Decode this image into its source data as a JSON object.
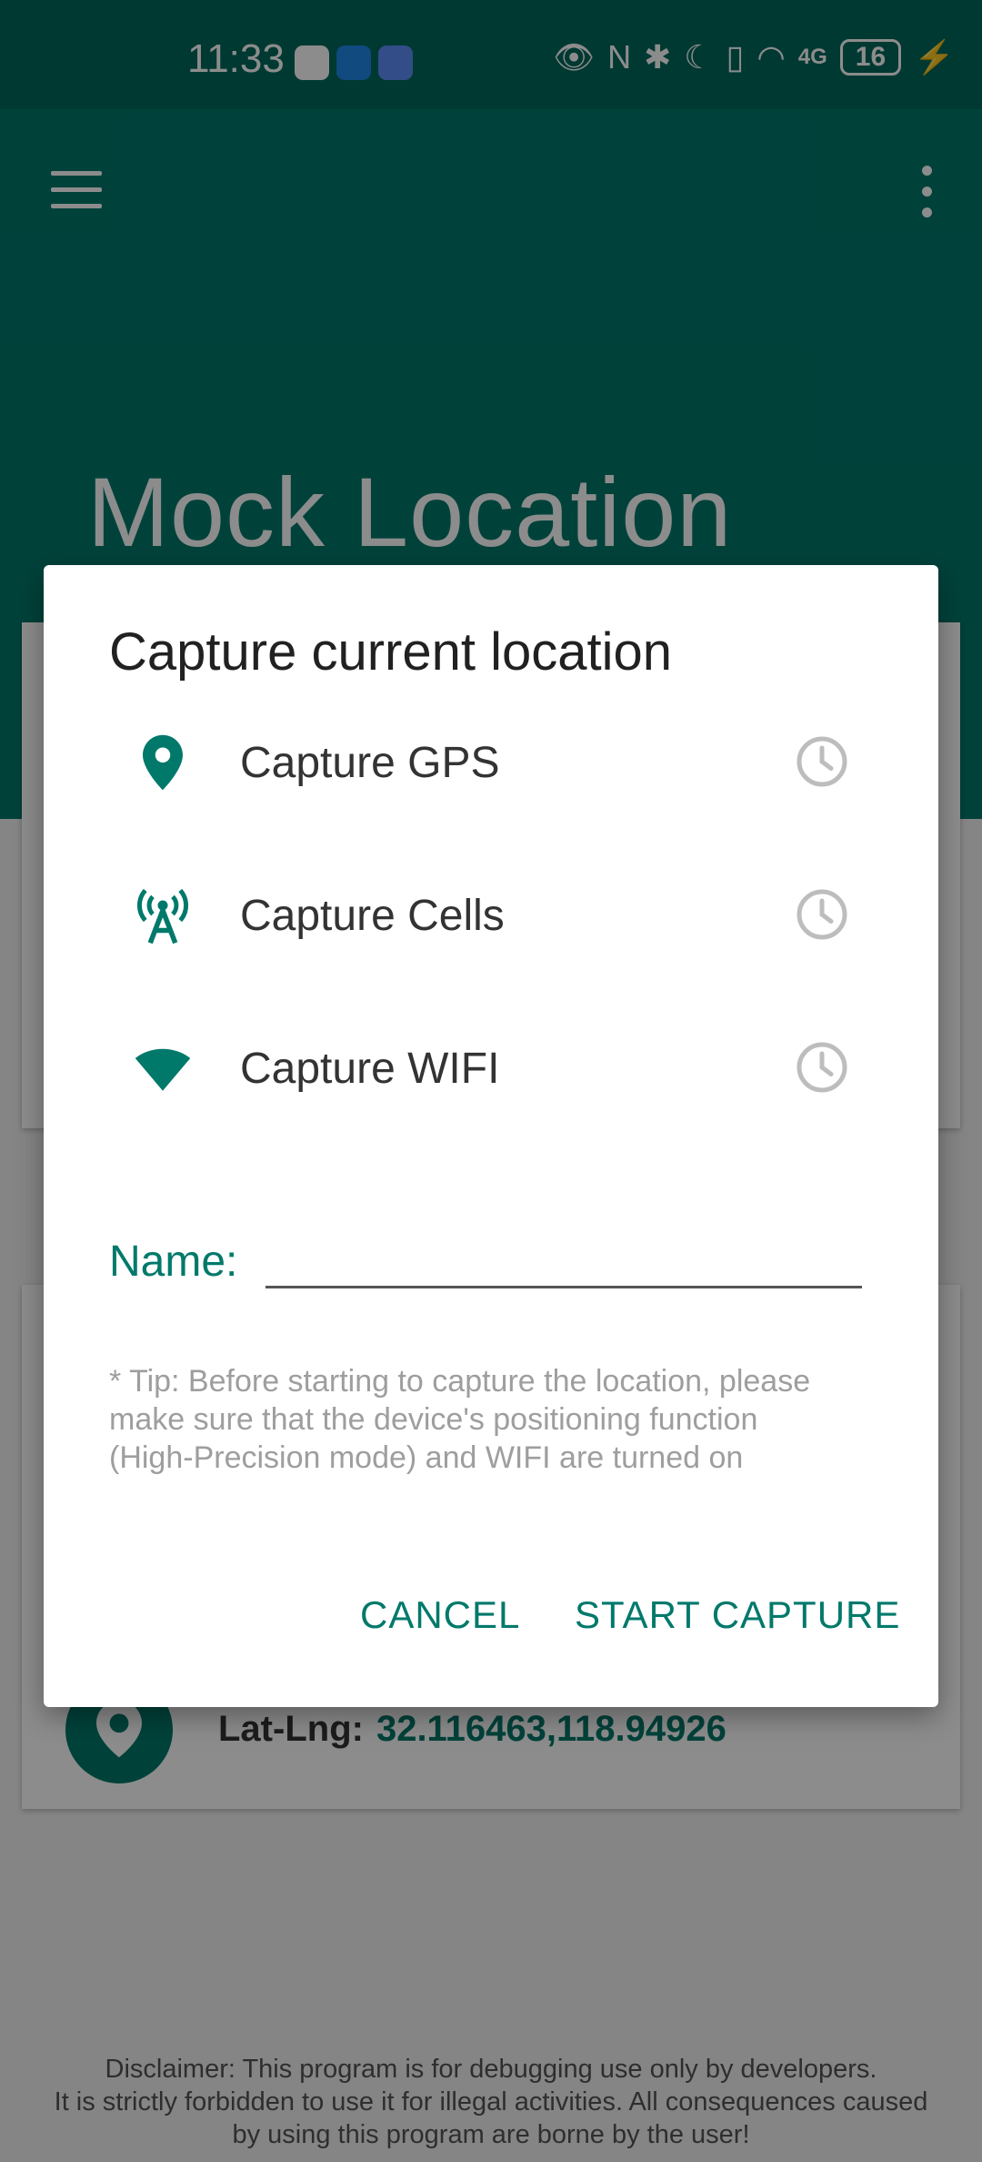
{
  "status_bar": {
    "time": "11:33",
    "battery": "16",
    "network": "4G"
  },
  "app": {
    "title": "Mock Location",
    "latlng_label": "Lat-Lng:",
    "latlng_value": "32.116463,118.94926",
    "disclaimer_lines": [
      "Disclaimer: This program is for debugging use only by developers.",
      "It is strictly forbidden to use it for illegal activities. All consequences caused",
      "by using this program are borne by the user!"
    ]
  },
  "dialog": {
    "title": "Capture current location",
    "options": [
      {
        "label": "Capture GPS",
        "icon": "location-pin-icon"
      },
      {
        "label": "Capture Cells",
        "icon": "cell-tower-icon"
      },
      {
        "label": "Capture WIFI",
        "icon": "wifi-icon"
      }
    ],
    "name_label": "Name:",
    "name_value": "",
    "tip": "* Tip: Before starting to capture the location, please make sure that the device's positioning function (High-Precision mode) and WIFI are turned on",
    "cancel_label": "CANCEL",
    "start_label": "START CAPTURE"
  },
  "colors": {
    "primary": "#00796b",
    "status_bar": "#00695c",
    "history_icon": "#bdbdbd"
  }
}
